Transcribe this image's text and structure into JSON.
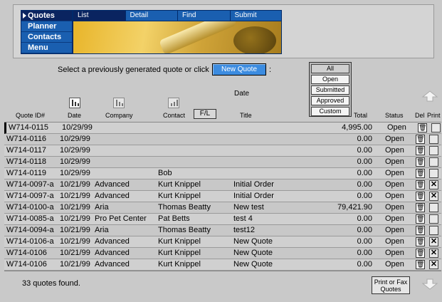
{
  "nav": {
    "items": [
      {
        "label": "Quotes",
        "active": true
      },
      {
        "label": "Planner",
        "active": false
      },
      {
        "label": "Contacts",
        "active": false
      },
      {
        "label": "Menu",
        "active": false
      }
    ],
    "subtabs": [
      {
        "label": "List",
        "active": true
      },
      {
        "label": "Detail",
        "active": false
      },
      {
        "label": "Find",
        "active": false
      },
      {
        "label": "Submit",
        "active": false
      }
    ]
  },
  "prompt": {
    "text": "Select a previously generated quote or click",
    "new_quote_label": "New Quote",
    "colon": ":"
  },
  "filters": [
    "All",
    "Open",
    "Submitted",
    "Approved",
    "Custom"
  ],
  "columns": {
    "date_top": "Date",
    "quote_id": "Quote ID#",
    "date": "Date",
    "company": "Company",
    "contact": "Contact",
    "fl": "F/L",
    "title": "Title",
    "total": "Total",
    "status": "Status",
    "del": "Del",
    "print": "Print"
  },
  "rows": [
    {
      "id": "W714-0115",
      "date": "10/29/99",
      "company": "",
      "contact": "",
      "title": "",
      "total": "4,995.00",
      "status": "Open",
      "print": ""
    },
    {
      "id": "W714-0116",
      "date": "10/29/99",
      "company": "",
      "contact": "",
      "title": "",
      "total": "0.00",
      "status": "Open",
      "print": ""
    },
    {
      "id": "W714-0117",
      "date": "10/29/99",
      "company": "",
      "contact": "",
      "title": "",
      "total": "0.00",
      "status": "Open",
      "print": ""
    },
    {
      "id": "W714-0118",
      "date": "10/29/99",
      "company": "",
      "contact": "",
      "title": "",
      "total": "0.00",
      "status": "Open",
      "print": ""
    },
    {
      "id": "W714-0119",
      "date": "10/29/99",
      "company": "",
      "contact": "Bob",
      "title": "",
      "total": "0.00",
      "status": "Open",
      "print": ""
    },
    {
      "id": "W714-0097-a",
      "date": "10/21/99",
      "company": "Advanced",
      "contact": "Kurt Knippel",
      "title": "Initial Order",
      "total": "0.00",
      "status": "Open",
      "print": "✕"
    },
    {
      "id": "W714-0097-a",
      "date": "10/21/99",
      "company": "Advanced",
      "contact": "Kurt Knippel",
      "title": "Initial Order",
      "total": "0.00",
      "status": "Open",
      "print": "✕"
    },
    {
      "id": "W714-0100-a",
      "date": "10/21/99",
      "company": "Aria",
      "contact": "Thomas Beatty",
      "title": "New test",
      "total": "79,421.90",
      "status": "Open",
      "print": ""
    },
    {
      "id": "W714-0085-a",
      "date": "10/21/99",
      "company": "Pro Pet Center",
      "contact": "Pat Betts",
      "title": "test 4",
      "total": "0.00",
      "status": "Open",
      "print": ""
    },
    {
      "id": "W714-0094-a",
      "date": "10/21/99",
      "company": "Aria",
      "contact": "Thomas Beatty",
      "title": "test12",
      "total": "0.00",
      "status": "Open",
      "print": ""
    },
    {
      "id": "W714-0106-a",
      "date": "10/21/99",
      "company": "Advanced",
      "contact": "Kurt Knippel",
      "title": "New Quote",
      "total": "0.00",
      "status": "Open",
      "print": "✕"
    },
    {
      "id": "W714-0106",
      "date": "10/21/99",
      "company": "Advanced",
      "contact": "Kurt Knippel",
      "title": "New Quote",
      "total": "0.00",
      "status": "Open",
      "print": "✕"
    },
    {
      "id": "W714-0106",
      "date": "10/21/99",
      "company": "Advanced",
      "contact": "Kurt Knippel",
      "title": "New Quote",
      "total": "0.00",
      "status": "Open",
      "print": "✕"
    }
  ],
  "footer": {
    "count_text": "33 quotes found.",
    "print_fax_label": "Print or Fax Quotes"
  },
  "icons": {
    "sort": "bar-chart-icon",
    "trash": "trash-icon",
    "print": "print-x-icon",
    "scroll_up": "up-arrow-icon",
    "scroll_down": "down-arrow-icon"
  }
}
